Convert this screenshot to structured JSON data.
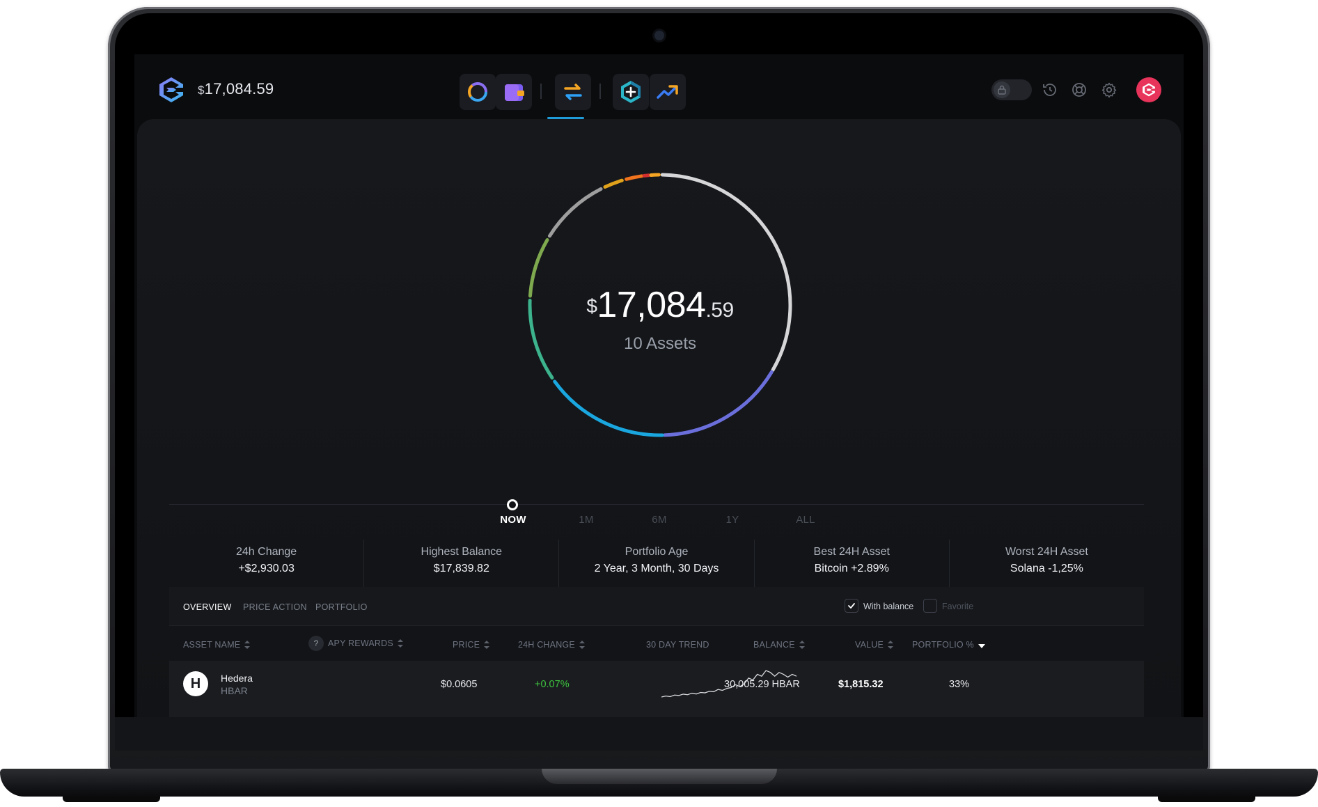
{
  "header": {
    "balance_currency": "$",
    "balance_amount": "17,084.59"
  },
  "nav": [
    {
      "name": "portfolio",
      "icon": "portfolio-ring-icon"
    },
    {
      "name": "wallet",
      "icon": "wallet-icon"
    },
    {
      "name": "exchange",
      "icon": "exchange-arrows-icon"
    },
    {
      "name": "apps",
      "icon": "add-app-hexagon-icon"
    },
    {
      "name": "trending",
      "icon": "trend-up-icon"
    }
  ],
  "right_icons": [
    "lock-icon",
    "history-icon",
    "help-lifebuoy-icon",
    "settings-gear-icon",
    "profile-avatar-icon"
  ],
  "summary": {
    "currency": "$",
    "whole": "17,084",
    "cents": ".59",
    "assets": "10 Assets"
  },
  "donut_segments_colors": [
    "#d6d6d8",
    "#6b6fdc",
    "#1aa7e0",
    "#3cb38c",
    "#7fa94e",
    "#9e9e9e",
    "#e0a21a",
    "#f0731e",
    "#d32f2f",
    "#f5a524"
  ],
  "timeline": {
    "labels": [
      "NOW",
      "1M",
      "6M",
      "1Y",
      "ALL"
    ],
    "active": "NOW"
  },
  "stats": [
    {
      "label": "24h Change",
      "value": "+$2,930.03"
    },
    {
      "label": "Highest Balance",
      "value": "$17,839.82"
    },
    {
      "label": "Portfolio Age",
      "value": "2 Year, 3 Month, 30 Days"
    },
    {
      "label": "Best 24H Asset",
      "value": "Bitcoin +2.89%"
    },
    {
      "label": "Worst 24H Asset",
      "value": "Solana -1,25%"
    }
  ],
  "table": {
    "tabs": [
      "OVERVIEW",
      "PRICE ACTION",
      "PORTFOLIO"
    ],
    "active_tab": "OVERVIEW",
    "filters": {
      "with_balance": {
        "label": "With balance",
        "checked": true
      },
      "favorite": {
        "label": "Favorite",
        "checked": false
      }
    },
    "help_icon_text": "?",
    "columns": [
      "ASSET NAME",
      "APY REWARDS",
      "PRICE",
      "24H CHANGE",
      "30 DAY TREND",
      "BALANCE",
      "VALUE",
      "PORTFOLIO %"
    ],
    "rows": [
      {
        "name": "Hedera",
        "ticker": "HBAR",
        "logo_letter": "H",
        "price": "$0.0605",
        "change": "+0.07%",
        "balance": "30,005.29 HBAR",
        "value": "$1,815.32",
        "portfolio": "33%",
        "trend": [
          2,
          2.5,
          2.2,
          3,
          2.8,
          3.5,
          3.2,
          4,
          3.6,
          4.4,
          4.2,
          5,
          4.8,
          6,
          5.5,
          6.5,
          7,
          8.5,
          7.5,
          9,
          12,
          11,
          14,
          13,
          16,
          15,
          13,
          15,
          14,
          12.5,
          14,
          13
        ]
      }
    ]
  }
}
